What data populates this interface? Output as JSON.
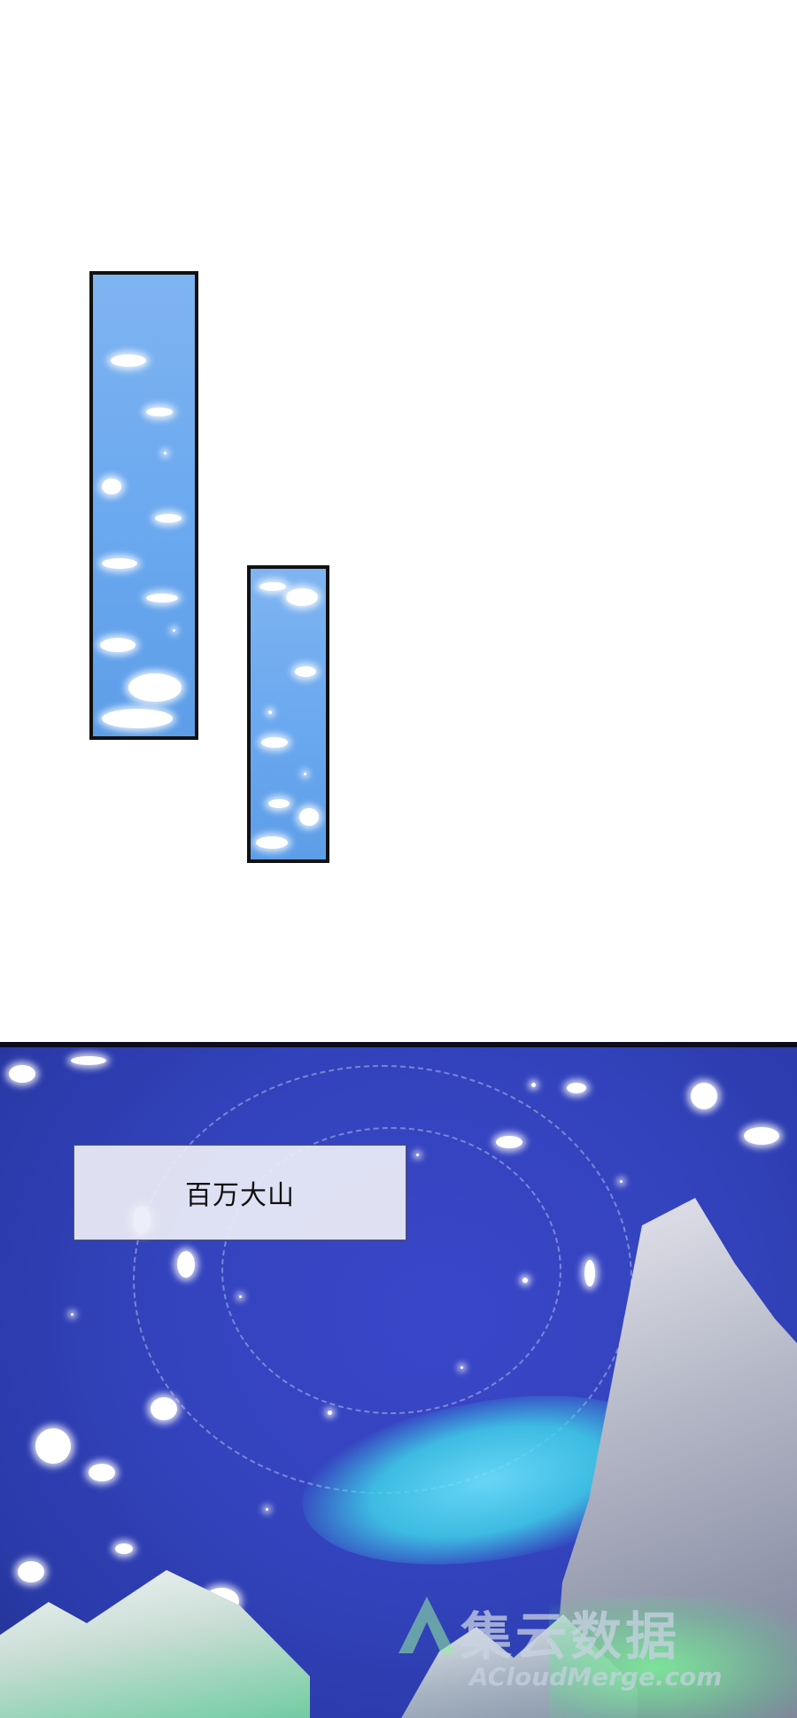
{
  "caption": {
    "text": "百万大山"
  },
  "watermark": {
    "chinese": "集云数据",
    "english": "ACloudMerge.com"
  },
  "colors": {
    "page_background": "#ffffff",
    "panel_border": "#111111",
    "sky_blue": "#6aa8ef",
    "night_sky": "#3343bd",
    "caption_background": "#ecedf6",
    "serpent_glow": "#3fd0e8",
    "green_glow": "#78ff96"
  },
  "icons": [
    "cloud-icon",
    "sparkle-icon",
    "mountain-icon",
    "watermark-logo-icon"
  ]
}
